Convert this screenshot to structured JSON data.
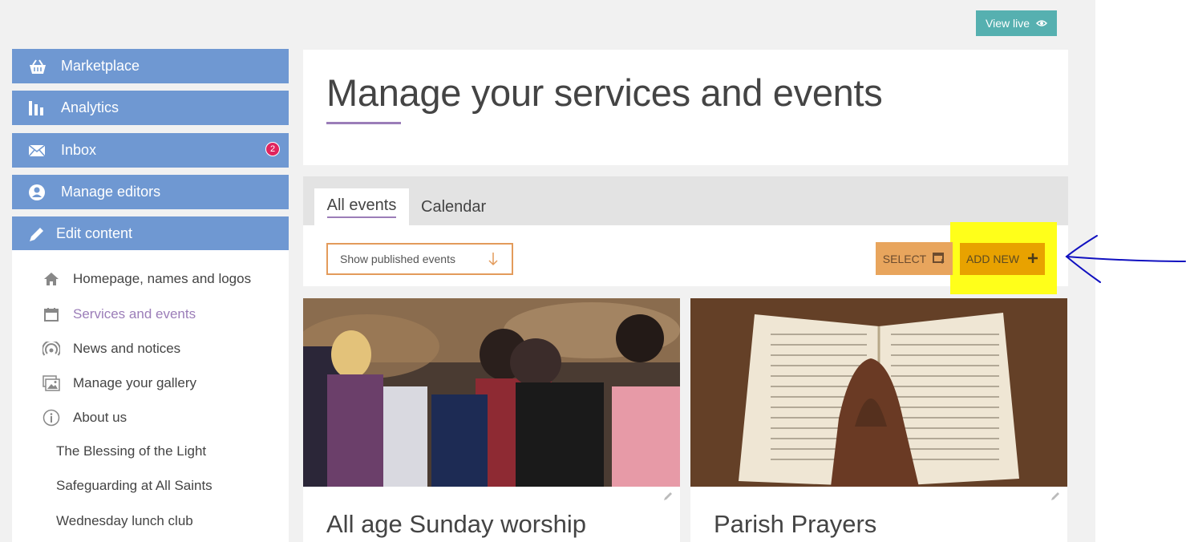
{
  "header": {
    "view_live_label": "View live"
  },
  "sidebar": {
    "nav": [
      {
        "label": "Marketplace",
        "icon": "basket-icon"
      },
      {
        "label": "Analytics",
        "icon": "bar-chart-icon"
      },
      {
        "label": "Inbox",
        "icon": "envelope-icon",
        "badge": "2"
      },
      {
        "label": "Manage editors",
        "icon": "user-circle-icon"
      },
      {
        "label": "Edit content",
        "icon": "pencil-icon"
      }
    ],
    "items": [
      {
        "label": "Homepage, names and logos",
        "icon": "home-icon"
      },
      {
        "label": "Services and events",
        "icon": "calendar-icon",
        "active": true
      },
      {
        "label": "News and notices",
        "icon": "broadcast-icon"
      },
      {
        "label": "Manage your gallery",
        "icon": "gallery-icon"
      },
      {
        "label": "About us",
        "icon": "info-icon"
      }
    ],
    "sub_items": [
      {
        "label": "The Blessing of the Light"
      },
      {
        "label": "Safeguarding at All Saints"
      },
      {
        "label": "Wednesday lunch club"
      }
    ]
  },
  "main": {
    "title": "Manage your services and events",
    "tabs": [
      {
        "label": "All events",
        "active": true
      },
      {
        "label": "Calendar"
      }
    ],
    "filter": {
      "selected": "Show published events"
    },
    "toolbar": {
      "select_label": "SELECT",
      "add_new_label": "ADD NEW"
    },
    "events": [
      {
        "title": "All age Sunday worship"
      },
      {
        "title": "Parish Prayers"
      }
    ]
  },
  "colors": {
    "sidebar_blue": "#6f98d2",
    "accent_purple": "#9b7db8",
    "view_live_teal": "#56b0b0",
    "select_orange": "#e8a55d",
    "add_new_orange": "#e8a200",
    "highlight_yellow": "#ffff1a",
    "annotation_arrow": "#1010c0",
    "badge_red": "#e0245e"
  }
}
